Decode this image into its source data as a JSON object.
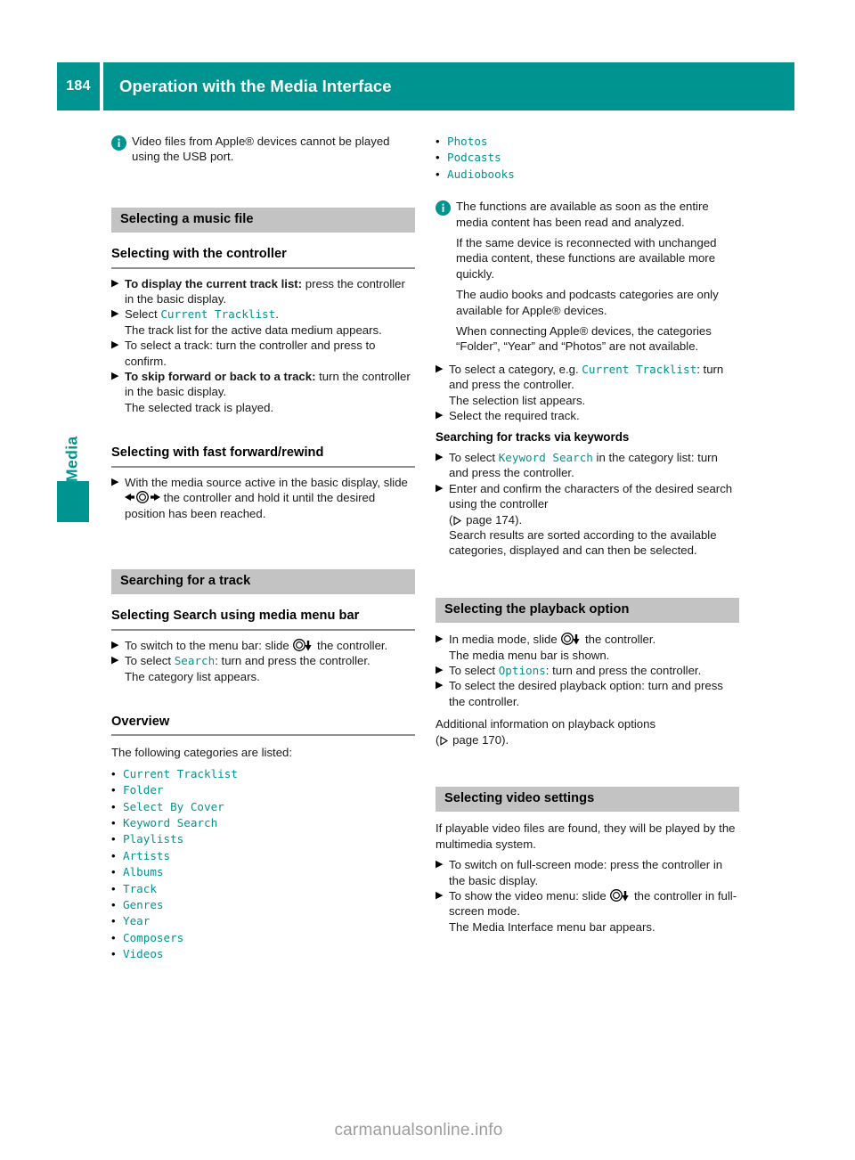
{
  "header": {
    "page_number": "184",
    "title": "Operation with the Media Interface",
    "accent_color": "#009490"
  },
  "side_tab": {
    "label": "Media"
  },
  "left_column": {
    "note_1": {
      "icon": "info-icon",
      "text": "Video files from Apple® devices cannot be played using the USB port."
    },
    "section_1": {
      "bar_title": "Selecting a music file",
      "subhead": "Selecting with the controller",
      "steps": [
        {
          "lead": "To display the current track list:",
          "rest": " press the controller in the basic display."
        },
        {
          "pre": "Select ",
          "token": "Current Tracklist",
          "post": ".",
          "follow": "The track list for the active data medium appears."
        },
        {
          "plain": "To select a track: turn the controller and press to confirm."
        },
        {
          "lead": "To skip forward or back to a track:",
          "rest": " turn the controller in the basic display.",
          "follow": "The selected track is played."
        }
      ],
      "subhead_2": "Selecting with fast forward/rewind",
      "step_ffwd": {
        "pre": "With the media source active in the basic display, slide ",
        "glyph": "slide-left-right-icon",
        "post": " the controller and hold it until the desired position has been reached."
      }
    },
    "section_2": {
      "bar_title": "Searching for a track",
      "subhead": "Selecting Search using media menu bar",
      "step_menu": {
        "pre": "To switch to the menu bar: slide ",
        "glyph": "slide-down-icon",
        "post": " the controller."
      },
      "step_search": {
        "pre": "To select ",
        "token": "Search",
        "post": ": turn and press the controller.",
        "follow": "The category list appears."
      },
      "subhead_2": "Overview",
      "intro": "The following categories are listed:",
      "categories": [
        "Current Tracklist",
        "Folder",
        "Select By Cover",
        "Keyword Search",
        "Playlists",
        "Artists",
        "Albums",
        "Track",
        "Genres",
        "Year",
        "Composers",
        "Videos"
      ]
    }
  },
  "right_column": {
    "categories_continued": [
      "Photos",
      "Podcasts",
      "Audiobooks"
    ],
    "note_1": {
      "icon": "info-icon",
      "paragraphs": [
        "The functions are available as soon as the entire media content has been read and analyzed.",
        "If the same device is reconnected with unchanged media content, these functions are available more quickly.",
        "The audio books and podcasts categories are only available for Apple® devices.",
        "When connecting Apple® devices, the categories “Folder”, “Year” and “Photos” are not available."
      ]
    },
    "step_category": {
      "pre": "To select a category, e.g. ",
      "token": "Current Tracklist",
      "post": ": turn and press the controller.",
      "follow": "The selection list appears."
    },
    "step_required_track": "Select the required track.",
    "subhead_keywords": "Searching for tracks via keywords",
    "step_keyword": {
      "pre": "To select ",
      "token": "Keyword Search",
      "post": " in the category list: turn and press the controller."
    },
    "step_enter": {
      "text": "Enter and confirm the characters of the desired search using the controller",
      "cross_ref": "page 174",
      "follow": "Search results are sorted according to the available categories, displayed and can then be selected."
    },
    "section_playback": {
      "bar_title": "Selecting the playback option",
      "step_media_mode": {
        "pre": "In media mode, slide ",
        "glyph": "slide-down-icon",
        "post": " the controller.",
        "follow": "The media menu bar is shown."
      },
      "step_options": {
        "pre": "To select ",
        "token": "Options",
        "post": ": turn and press the controller."
      },
      "step_desired": "To select the desired playback option: turn and press the controller.",
      "additional_info": "Additional information on playback options",
      "cross_ref": "page 170"
    },
    "section_video": {
      "bar_title": "Selecting video settings",
      "intro": "If playable video files are found, they will be played by the multimedia system.",
      "step_fullscreen": "To switch on full-screen mode: press the controller in the basic display.",
      "step_video_menu": {
        "pre": "To show the video menu: slide ",
        "glyph": "slide-down-icon",
        "post": " the controller in full-screen mode.",
        "follow": "The Media Interface menu bar appears."
      }
    }
  },
  "watermark": "carmanualsonline.info"
}
